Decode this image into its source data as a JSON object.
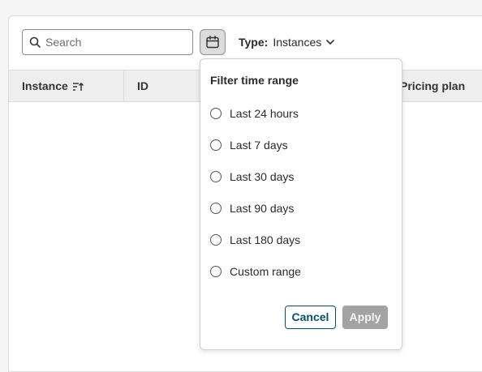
{
  "toolbar": {
    "search_placeholder": "Search",
    "search_value": "",
    "search_icon": "search-icon",
    "calendar_icon": "calendar-icon",
    "type_label": "Type:",
    "type_value": "Instances",
    "type_chevron_icon": "chevron-down-icon"
  },
  "table": {
    "columns": {
      "instance": "Instance",
      "id": "ID",
      "pricing": "Pricing plan"
    },
    "sort_icon": "sort-ascending-icon"
  },
  "time_filter": {
    "title": "Filter time range",
    "options": [
      {
        "label": "Last 24 hours",
        "selected": false
      },
      {
        "label": "Last 7 days",
        "selected": false
      },
      {
        "label": "Last 30 days",
        "selected": false
      },
      {
        "label": "Last 90 days",
        "selected": false
      },
      {
        "label": "Last 180 days",
        "selected": false
      },
      {
        "label": "Custom range",
        "selected": false
      }
    ],
    "cancel_label": "Cancel",
    "apply_label": "Apply",
    "apply_enabled": false
  },
  "colors": {
    "accent": "#0a4f6e",
    "disabled_button": "#a3a3a3",
    "header_bg": "#eeeeee"
  }
}
